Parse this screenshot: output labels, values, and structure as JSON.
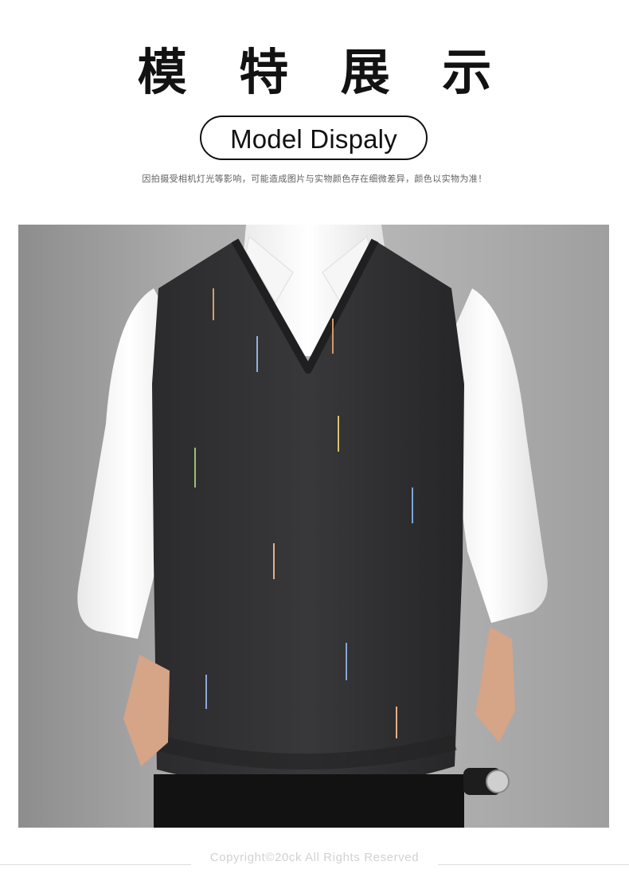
{
  "header": {
    "title_zh": "模 特 展 示",
    "title_en": "Model Dispaly",
    "notice": "因拍摄受相机灯光等影响，可能造成图片与实物颜色存在细微差异，颜色以实物为准！"
  },
  "photo": {
    "subject": "model-photo",
    "colors": {
      "vest": "#2f2f31",
      "shirt": "#f3f3f3",
      "background": "#aeaeae",
      "pants": "#121212"
    }
  },
  "footer": {
    "copyright": "Copyright©20ck All Rights Reserved"
  }
}
